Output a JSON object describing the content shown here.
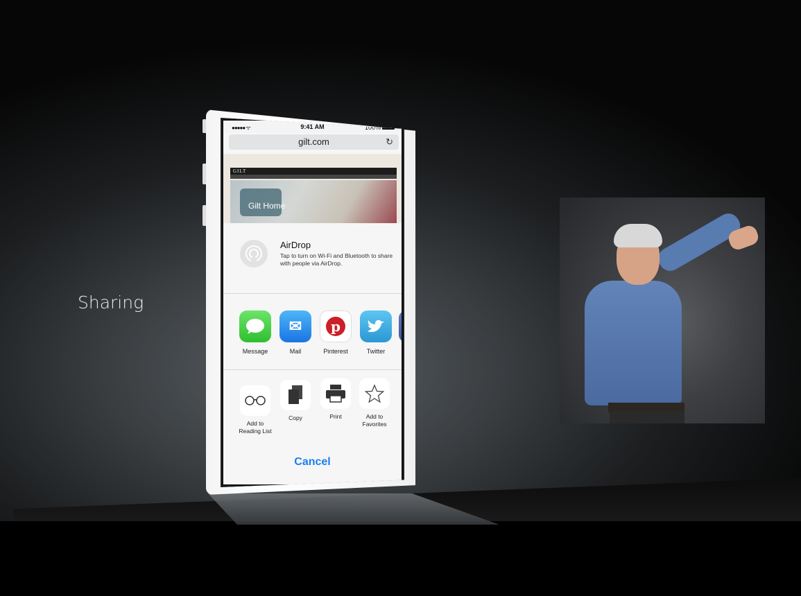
{
  "slide": {
    "title": "Sharing"
  },
  "phone": {
    "status": {
      "signal": "●●●●● ᯤ",
      "time": "9:41 AM",
      "battery": "100%"
    },
    "url": "gilt.com",
    "webpage": {
      "logo": "GILT",
      "hero_text": "Gilt Home"
    },
    "airdrop": {
      "title": "AirDrop",
      "description": "Tap to turn on Wi-Fi and Bluetooth to share with people via AirDrop."
    },
    "share_apps": [
      {
        "label": "Message",
        "icon": "message-icon"
      },
      {
        "label": "Mail",
        "icon": "mail-icon"
      },
      {
        "label": "Pinterest",
        "icon": "pinterest-icon"
      },
      {
        "label": "Twitter",
        "icon": "twitter-icon"
      },
      {
        "label": "Fa",
        "icon": "facebook-icon"
      }
    ],
    "actions": [
      {
        "label": "Add to Reading List",
        "icon": "glasses-icon"
      },
      {
        "label": "Copy",
        "icon": "copy-icon"
      },
      {
        "label": "Print",
        "icon": "printer-icon"
      },
      {
        "label": "Add to Favorites",
        "icon": "star-icon"
      }
    ],
    "cancel_label": "Cancel"
  },
  "colors": {
    "accent": "#1a7ff0",
    "backdrop": "#3a3e41"
  }
}
